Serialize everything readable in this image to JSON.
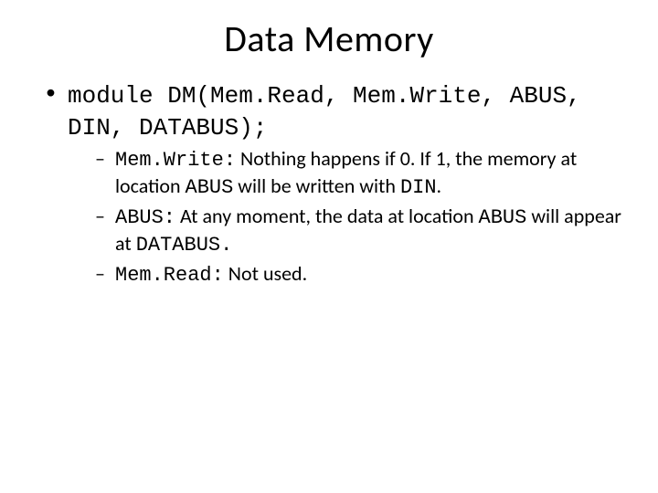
{
  "title": "Data Memory",
  "module_line_parts": {
    "p1": "module DM(Mem.Read, Mem.Write, ABUS, DIN, DATABUS);"
  },
  "items": [
    {
      "term": "Mem.Write:",
      "desc_a": " Nothing happens if 0. If 1, the memory at location ",
      "code_a": "ABUS",
      "desc_b": " will be written with ",
      "code_b": "DIN",
      "desc_c": "."
    },
    {
      "term": "ABUS:",
      "desc_a": " At any moment, the data at location ",
      "code_a": "ABUS",
      "desc_b": " will appear at ",
      "code_b": "DATABUS.",
      "desc_c": ""
    },
    {
      "term": "Mem.Read:",
      "desc_a": " Not used.",
      "code_a": "",
      "desc_b": "",
      "code_b": "",
      "desc_c": ""
    }
  ]
}
